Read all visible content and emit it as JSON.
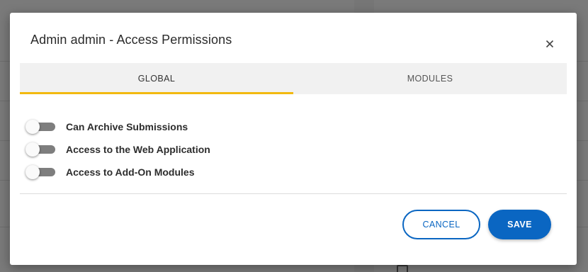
{
  "modal": {
    "title": "Admin admin - Access Permissions",
    "close_icon": "close-icon"
  },
  "tabs": [
    {
      "label": "GLOBAL",
      "active": true
    },
    {
      "label": "MODULES",
      "active": false
    }
  ],
  "permissions": [
    {
      "label": "Can Archive Submissions",
      "enabled": false
    },
    {
      "label": "Access to the Web Application",
      "enabled": false
    },
    {
      "label": "Access to Add-On Modules",
      "enabled": false
    }
  ],
  "actions": {
    "cancel_label": "CANCEL",
    "save_label": "SAVE"
  },
  "colors": {
    "accent": "#0a66c2",
    "tab_indicator": "#f2b90f",
    "toggle_off_track": "#7e7e7e"
  }
}
